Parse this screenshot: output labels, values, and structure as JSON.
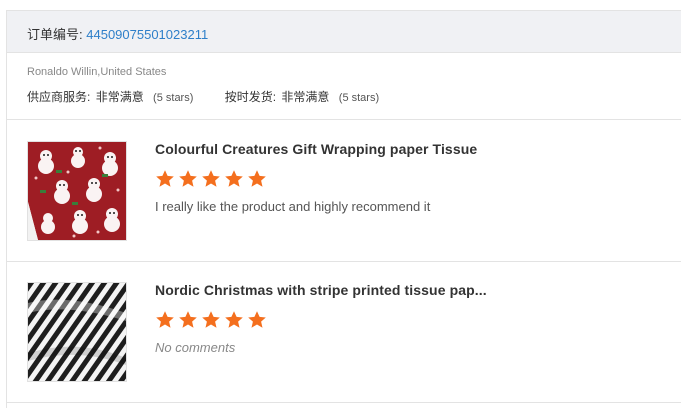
{
  "order": {
    "label": "订单编号:",
    "number": "44509075501023211"
  },
  "buyer": "Ronaldo Willin,United States",
  "ratings": [
    {
      "label": "供应商服务:",
      "value": "非常满意",
      "stars_text": "(5 stars)"
    },
    {
      "label": "按时发货:",
      "value": "非常满意",
      "stars_text": "(5 stars)"
    }
  ],
  "products": [
    {
      "title": "Colourful Creatures Gift Wrapping paper Tissue",
      "rating": 5,
      "comment": "I really like the product and highly recommend it",
      "thumbnail": "red-christmas-wrapping-paper"
    },
    {
      "title": "Nordic Christmas with stripe printed tissue pap...",
      "rating": 5,
      "comment": "No comments",
      "thumbnail": "black-white-stripe-tissue"
    }
  ],
  "colors": {
    "accent_link": "#2e7fc9",
    "star": "#f46f1e",
    "header_bg": "#f0f1f4"
  }
}
